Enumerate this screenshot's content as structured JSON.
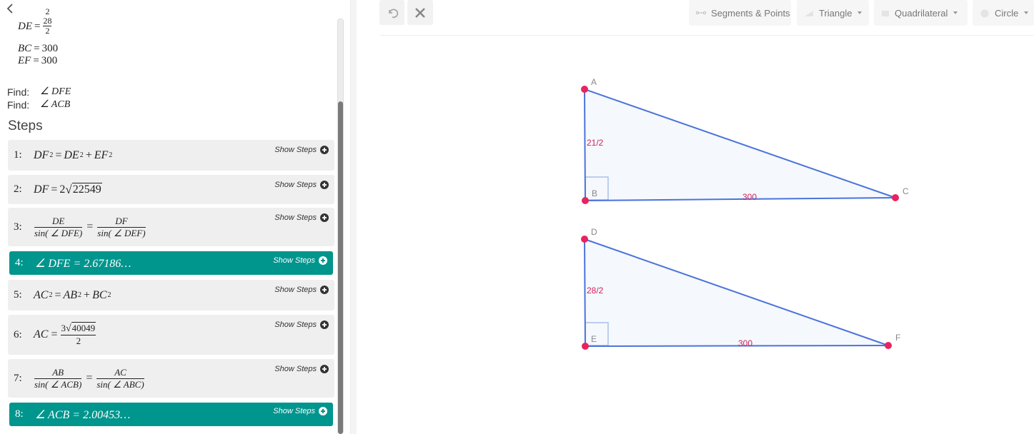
{
  "givens": {
    "de_label": "DE",
    "de_top_partial": "2",
    "de_num": "28",
    "de_den": "2",
    "bc_label": "BC",
    "bc_value": "300",
    "ef_label": "EF",
    "ef_value": "300"
  },
  "find": [
    {
      "label": "Find:",
      "value": "∠ DFE"
    },
    {
      "label": "Find:",
      "value": "∠ ACB"
    }
  ],
  "steps_heading": "Steps",
  "show_steps_label": "Show Steps",
  "steps": [
    {
      "num": "1:",
      "a": "DF",
      "b": "DE",
      "c": "EF",
      "exp": "2"
    },
    {
      "num": "2:",
      "lhs": "DF",
      "coef": "2",
      "radicand": "22549"
    },
    {
      "num": "3:",
      "n1": "DE",
      "d1": "sin( ∠ DFE)",
      "n2": "DF",
      "d2": "sin( ∠ DEF)"
    },
    {
      "num": "4:",
      "text": "∠ DFE = 2.67186…",
      "active": true
    },
    {
      "num": "5:",
      "a": "AC",
      "b": "AB",
      "c": "BC",
      "exp": "2"
    },
    {
      "num": "6:",
      "lhs": "AC",
      "coef": "3",
      "radicand": "40049",
      "den": "2"
    },
    {
      "num": "7:",
      "n1": "AB",
      "d1": "sin( ∠ ACB)",
      "n2": "AC",
      "d2": "sin( ∠ ABC)"
    },
    {
      "num": "8:",
      "text": "∠ ACB = 2.00453…",
      "active": true
    }
  ],
  "toolbar": {
    "undo_icon": "undo-icon",
    "clear_icon": "close-icon",
    "segments_label": "Segments & Points",
    "triangle_label": "Triangle",
    "quadrilateral_label": "Quadrilateral",
    "circle_label": "Circle"
  },
  "figure": {
    "point_labels": {
      "A": "A",
      "B": "B",
      "C": "C",
      "D": "D",
      "E": "E",
      "F": "F"
    },
    "triangle_abc": {
      "side_ab": "21/2",
      "side_bc": "300"
    },
    "triangle_def": {
      "side_de": "28/2",
      "side_ef": "300"
    },
    "colors": {
      "line": "#4a73db",
      "fill": "#f5f8fd",
      "point": "#e8235e",
      "right_angle": "#a9bfec",
      "label": "#d0245c"
    }
  }
}
